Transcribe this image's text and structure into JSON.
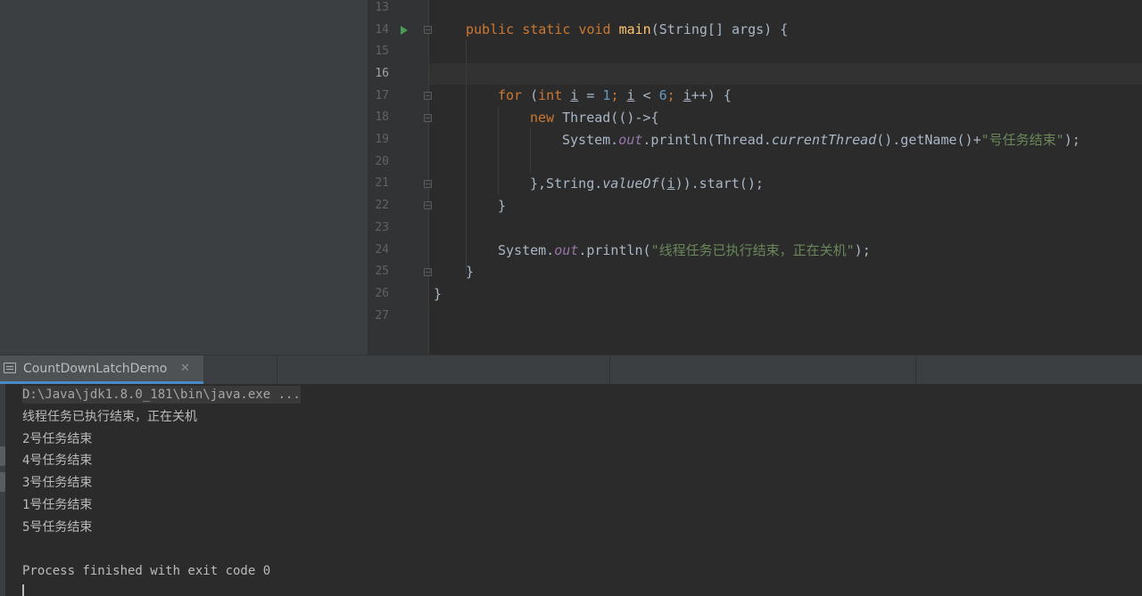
{
  "editor": {
    "line_numbers": [
      "13",
      "14",
      "15",
      "16",
      "17",
      "18",
      "19",
      "20",
      "21",
      "22",
      "23",
      "24",
      "25",
      "26",
      "27"
    ],
    "active_line": "16",
    "code": {
      "l14": {
        "public": "public",
        "static": "static",
        "void": "void",
        "main": "main",
        "sig": "(String[] args) {"
      },
      "l17": {
        "for": "for",
        "open": " (",
        "int": "int",
        "i1": "i",
        "eq": " = ",
        "one": "1",
        "semi1": "; ",
        "i2": "i",
        "lt": " < ",
        "six": "6",
        "semi2": "; ",
        "i3": "i",
        "rest": "++) {"
      },
      "l18": {
        "new": "new",
        "rest": " Thread(()->{"
      },
      "l19": {
        "system": "System.",
        "out": "out",
        "println": ".println(Thread.",
        "current_thread": "currentThread",
        "getname": "().getName()+",
        "str": "\"号任务结束\"",
        "end": ");"
      },
      "l21": {
        "start": "},String.",
        "valueof": "valueOf",
        "paren": "(",
        "i": "i",
        "rest": ")).start();"
      },
      "l22": {
        "brace": "}"
      },
      "l24": {
        "system": "System.",
        "out": "out",
        "println": ".println(",
        "str": "\"线程任务已执行结束，正在关机\"",
        "end": ");"
      },
      "l25": {
        "brace": "}"
      },
      "l26": {
        "brace": "}"
      }
    }
  },
  "run_panel": {
    "tab_label": "CountDownLatchDemo",
    "close_glyph": "✕",
    "tab_icon": "console-icon"
  },
  "console": {
    "command": "D:\\Java\\jdk1.8.0_181\\bin\\java.exe ...",
    "lines": [
      "线程任务已执行结束，正在关机",
      "2号任务结束",
      "4号任务结束",
      "3号任务结束",
      "1号任务结束",
      "5号任务结束"
    ],
    "exit_message": "Process finished with exit code 0"
  },
  "colors": {
    "keyword": "#cc7832",
    "function": "#ffc66d",
    "number": "#6897bb",
    "string": "#6a8759",
    "field": "#9876aa",
    "text": "#a9b7c6",
    "run_icon": "#499c54",
    "tab_accent": "#4a88c7"
  }
}
